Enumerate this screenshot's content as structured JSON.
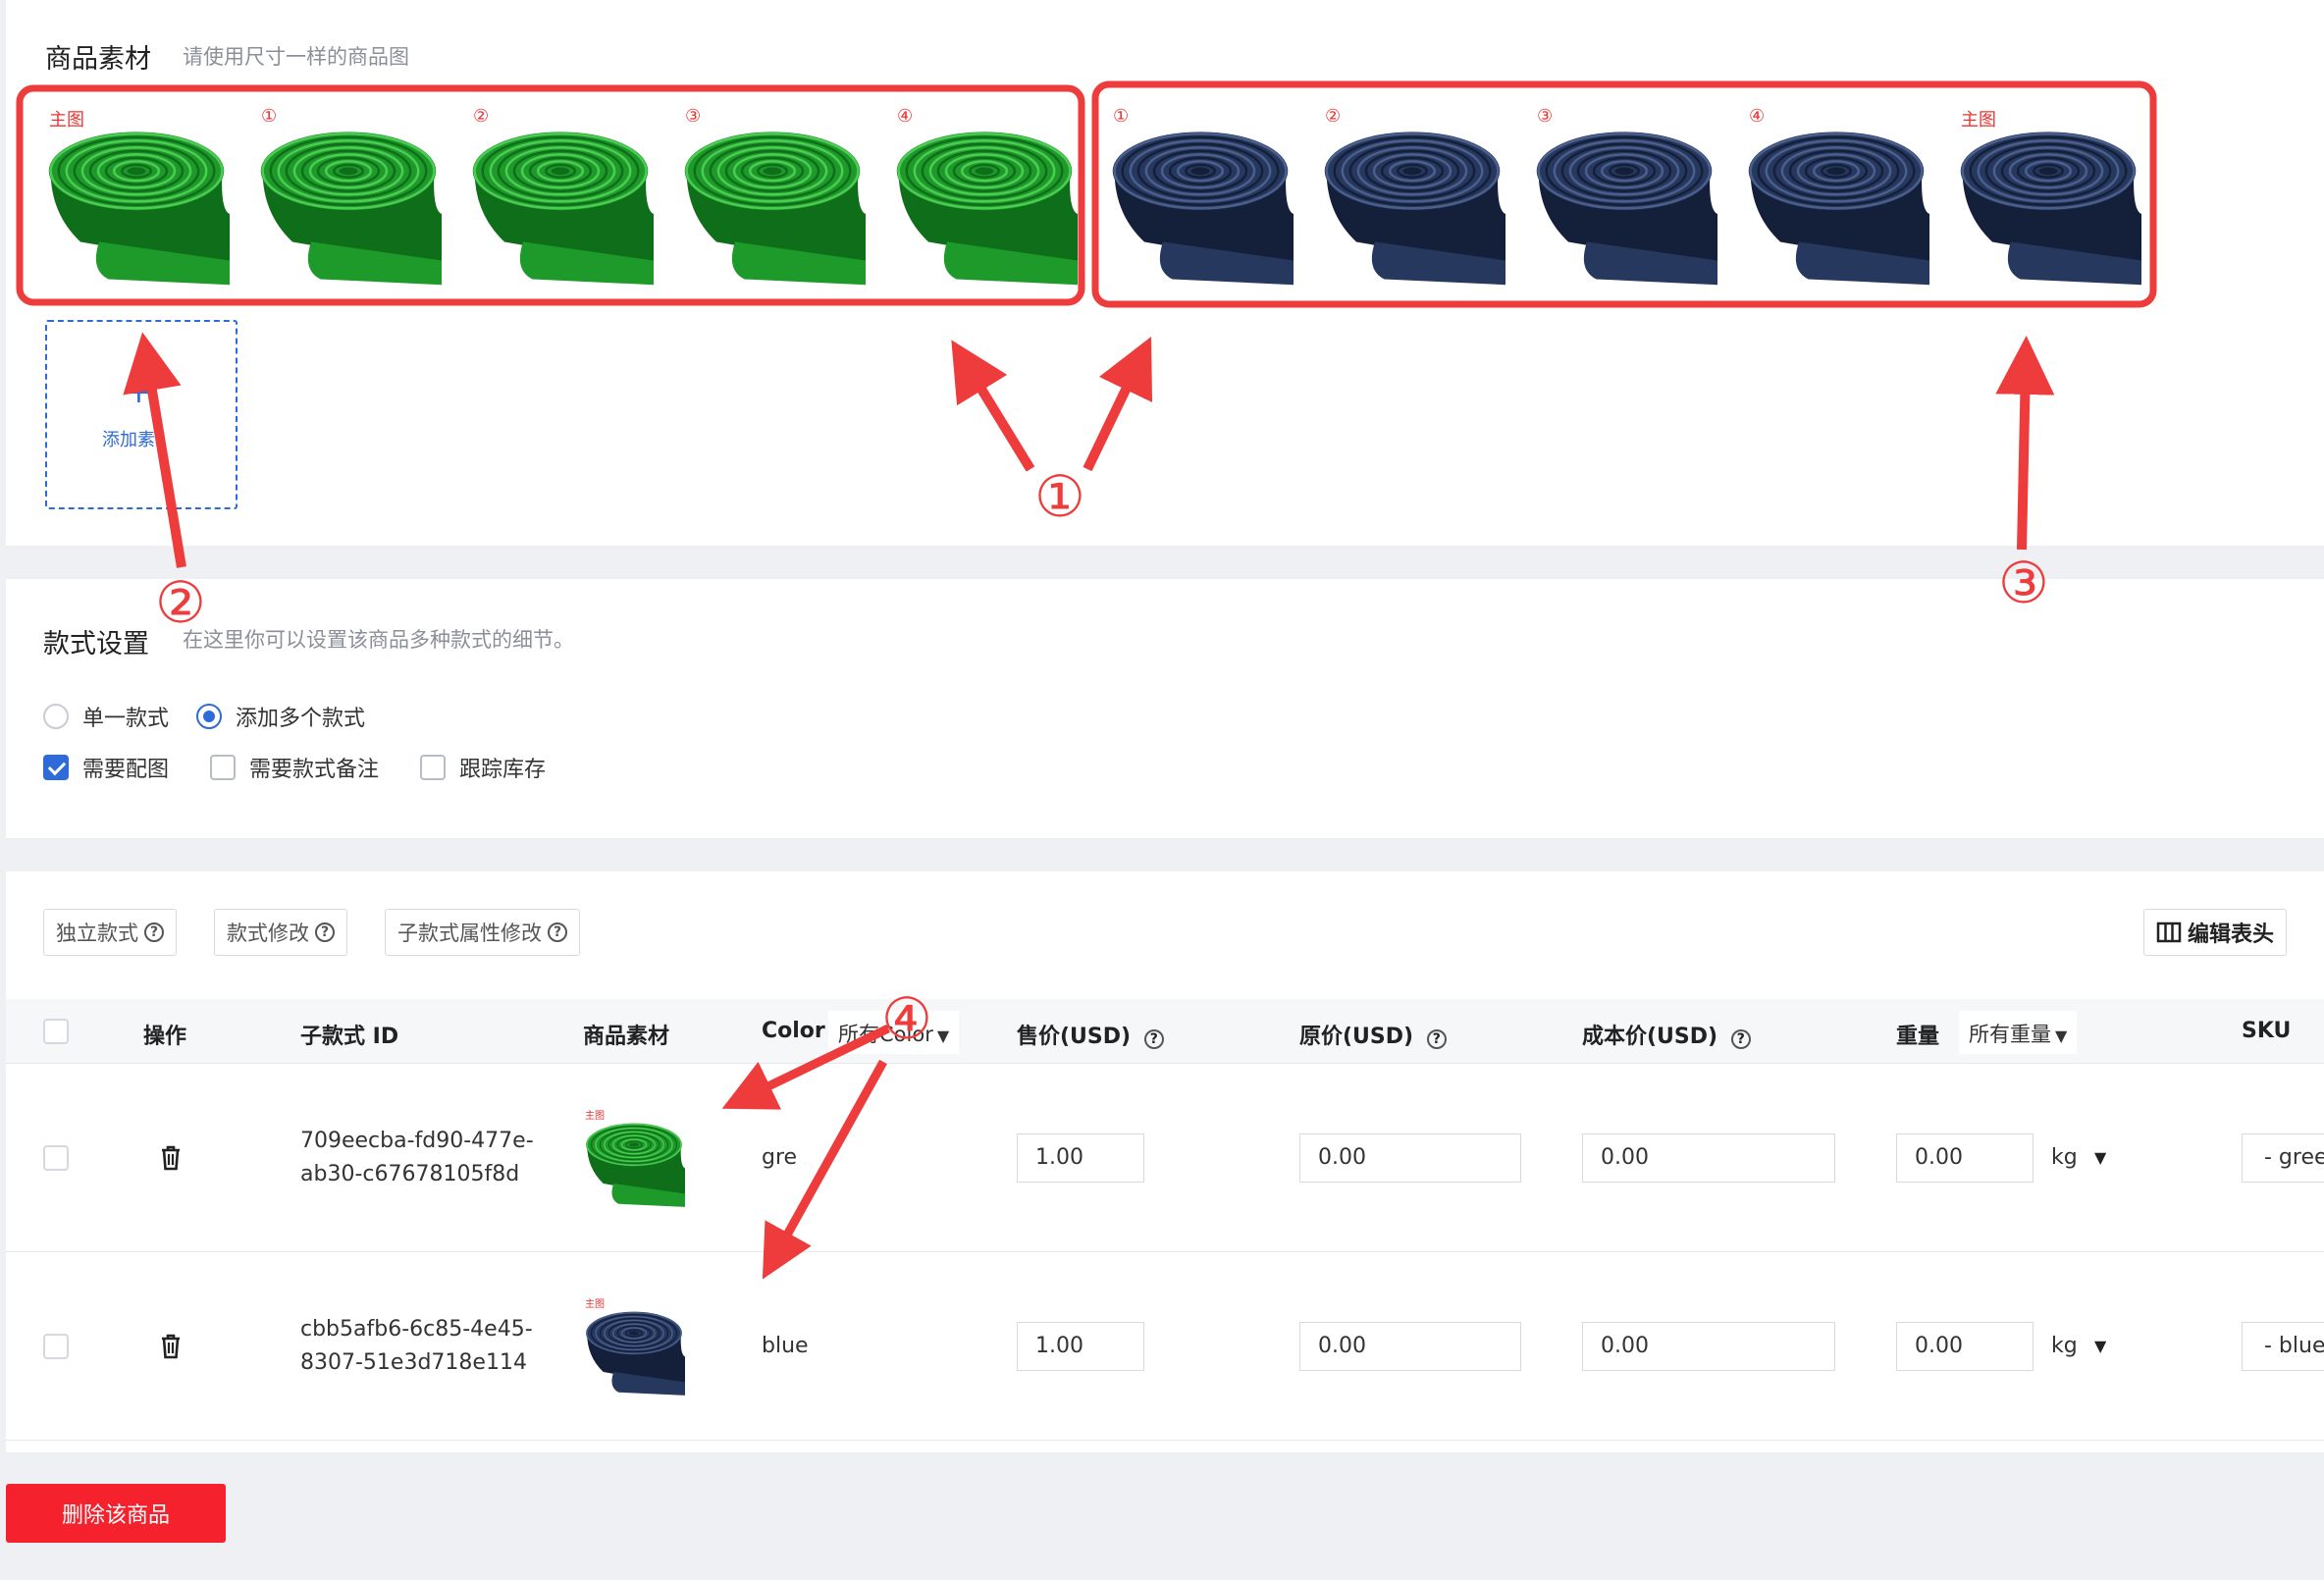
{
  "materials": {
    "title": "商品素材",
    "hint": "请使用尺寸一样的商品图",
    "green_images": [
      {
        "label": "主图",
        "color": "green"
      },
      {
        "label": "①",
        "color": "green"
      },
      {
        "label": "②",
        "color": "green"
      },
      {
        "label": "③",
        "color": "green"
      },
      {
        "label": "④",
        "color": "green"
      }
    ],
    "blue_images": [
      {
        "label": "①",
        "color": "blue"
      },
      {
        "label": "②",
        "color": "blue"
      },
      {
        "label": "③",
        "color": "blue"
      },
      {
        "label": "④",
        "color": "blue"
      },
      {
        "label": "主图",
        "color": "blue"
      }
    ],
    "add_label": "添加素",
    "add_plus": "+"
  },
  "style_settings": {
    "title": "款式设置",
    "hint": "在这里你可以设置该商品多种款式的细节。",
    "radio_single": "单一款式",
    "radio_multi": "添加多个款式",
    "check_need_image": "需要配图",
    "check_need_note": "需要款式备注",
    "check_track_stock": "跟踪库存"
  },
  "toolbar": {
    "independent": "独立款式",
    "modify": "款式修改",
    "sub_attr_modify": "子款式属性修改",
    "edit_header": "编辑表头"
  },
  "table": {
    "headers": {
      "action": "操作",
      "sub_id": "子款式 ID",
      "material": "商品素材",
      "color": "Color",
      "color_filter": "所有Color",
      "price": "售价(USD)",
      "orig_price": "原价(USD)",
      "cost": "成本价(USD)",
      "weight": "重量",
      "weight_filter": "所有重量",
      "sku": "SKU"
    },
    "rows": [
      {
        "id_line1": "709eecba-fd90-477e-",
        "id_line2": "ab30-c67678105f8d",
        "thumb_label": "主图",
        "color": "gre",
        "price": "1.00",
        "orig_price": "0.00",
        "cost": "0.00",
        "weight": "0.00",
        "unit": "kg",
        "sku": "- gree"
      },
      {
        "id_line1": "cbb5afb6-6c85-4e45-",
        "id_line2": "8307-51e3d718e114",
        "thumb_label": "主图",
        "color": "blue",
        "price": "1.00",
        "orig_price": "0.00",
        "cost": "0.00",
        "weight": "0.00",
        "unit": "kg",
        "sku": "- blue"
      }
    ]
  },
  "delete_button": "删除该商品",
  "annotations": [
    "①",
    "②",
    "③",
    "④"
  ],
  "colors": {
    "accent": "#2f6bd8",
    "annotation": "#ee3b3b",
    "green_product": "#1e9a2a",
    "blue_product": "#27385e",
    "danger": "#f5222d"
  }
}
